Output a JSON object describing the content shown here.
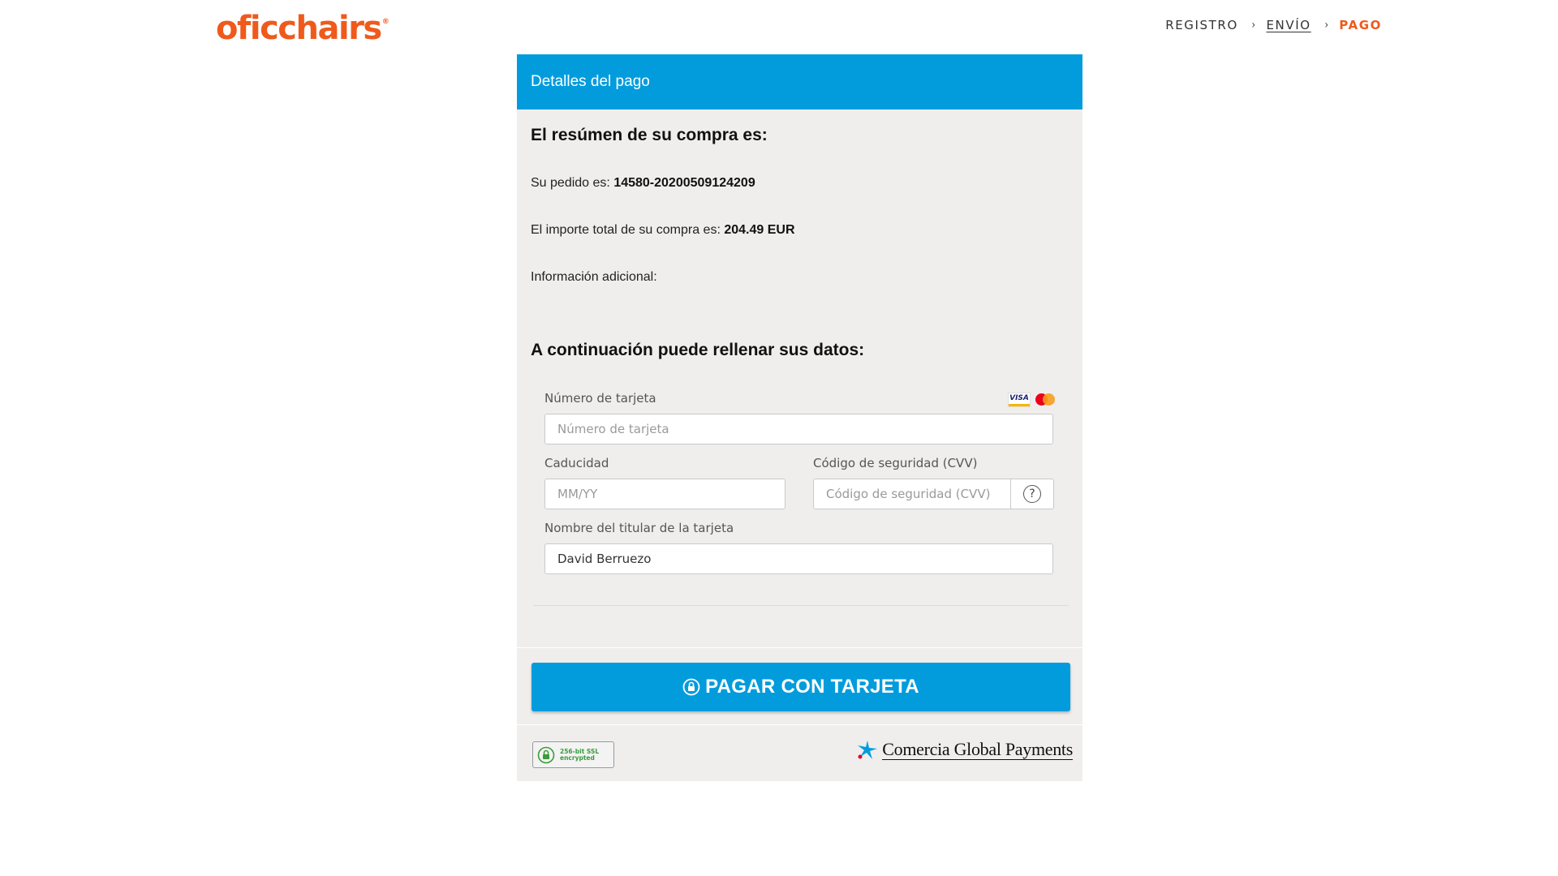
{
  "brand": {
    "logo_text": "oficchairs",
    "registered_mark": "®",
    "logo_color": "#ef5a1c"
  },
  "breadcrumb": {
    "steps": [
      {
        "label": "REGISTRO",
        "state": "done"
      },
      {
        "label": "ENVÍO",
        "state": "link"
      },
      {
        "label": "PAGO",
        "state": "current"
      }
    ],
    "separator": "›"
  },
  "panel": {
    "header": "Detalles del pago",
    "summary_heading": "El resúmen de su compra es:",
    "order_label": "Su pedido es:",
    "order_value": "14580-20200509124209",
    "amount_label": "El importe total de su compra es:",
    "amount_value": "204.49 EUR",
    "extra_label": "Información adicional:",
    "form_heading": "A continuación puede rellenar sus datos:"
  },
  "form": {
    "card_number": {
      "label": "Número de tarjeta",
      "placeholder": "Número de tarjeta",
      "value": ""
    },
    "expiry": {
      "label": "Caducidad",
      "placeholder": "MM/YY",
      "value": ""
    },
    "cvv": {
      "label": "Código de seguridad (CVV)",
      "placeholder": "Código de seguridad (CVV)",
      "value": "",
      "help_symbol": "?"
    },
    "holder": {
      "label": "Nombre del titular de la tarjeta",
      "placeholder": "",
      "value": "David Berruezo"
    },
    "card_logos": {
      "visa": "VISA",
      "mastercard_icon": "mastercard-icon"
    }
  },
  "actions": {
    "pay_label": "PAGAR CON TARJETA",
    "pay_icon": "lock-icon"
  },
  "footer": {
    "ssl_line1": "256-bit SSL",
    "ssl_line2": "encrypted",
    "provider": "Comercia Global Payments"
  },
  "colors": {
    "accent": "#029cdd",
    "brand_orange": "#ef5a1c",
    "panel_bg": "#efeeed"
  }
}
